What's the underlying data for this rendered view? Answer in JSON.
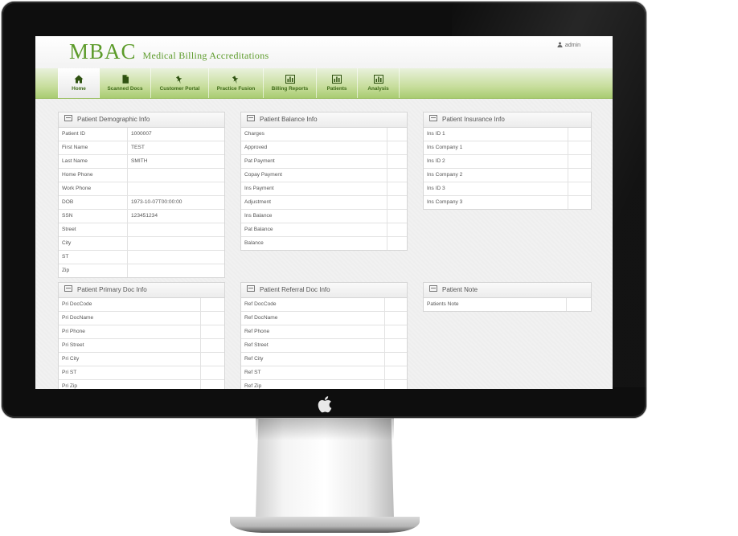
{
  "app": {
    "logo_main": "MBAC",
    "logo_sub": "Medical Billing Accreditations",
    "user": "admin"
  },
  "nav": [
    {
      "label": "Home",
      "icon": "home-icon",
      "active": true
    },
    {
      "label": "Scanned Docs",
      "icon": "document-icon",
      "active": false
    },
    {
      "label": "Customer Portal",
      "icon": "pushpin-icon",
      "active": false
    },
    {
      "label": "Practice Fusion",
      "icon": "pushpin-icon",
      "active": false
    },
    {
      "label": "Billing Reports",
      "icon": "bar-chart-icon",
      "active": false
    },
    {
      "label": "Patients",
      "icon": "bar-chart-icon",
      "active": false
    },
    {
      "label": "Analysis",
      "icon": "bar-chart-icon",
      "active": false
    }
  ],
  "panels": {
    "demographic": {
      "title": "Patient Demographic Info",
      "rows": [
        {
          "label": "Patient ID",
          "value": "1000007"
        },
        {
          "label": "First Name",
          "value": "TEST"
        },
        {
          "label": "Last Name",
          "value": "SMITH"
        },
        {
          "label": "Home Phone",
          "value": ""
        },
        {
          "label": "Work Phone",
          "value": ""
        },
        {
          "label": "DOB",
          "value": "1973-10-07T00:00:00"
        },
        {
          "label": "SSN",
          "value": "123451234"
        },
        {
          "label": "Street",
          "value": ""
        },
        {
          "label": "City",
          "value": ""
        },
        {
          "label": "ST",
          "value": ""
        },
        {
          "label": "Zip",
          "value": ""
        }
      ]
    },
    "balance": {
      "title": "Patient Balance Info",
      "rows": [
        {
          "label": "Charges",
          "value": ""
        },
        {
          "label": "Approved",
          "value": ""
        },
        {
          "label": "Pat Payment",
          "value": ""
        },
        {
          "label": "Copay Payment",
          "value": ""
        },
        {
          "label": "Ins Payment",
          "value": ""
        },
        {
          "label": "Adjustment",
          "value": ""
        },
        {
          "label": "Ins Balance",
          "value": ""
        },
        {
          "label": "Pat Balance",
          "value": ""
        },
        {
          "label": "Balance",
          "value": ""
        }
      ]
    },
    "insurance": {
      "title": "Patient Insurance Info",
      "rows": [
        {
          "label": "Ins ID 1",
          "value": ""
        },
        {
          "label": "Ins Company 1",
          "value": ""
        },
        {
          "label": "Ins ID 2",
          "value": ""
        },
        {
          "label": "Ins Company 2",
          "value": ""
        },
        {
          "label": "Ins ID 3",
          "value": ""
        },
        {
          "label": "Ins Company 3",
          "value": ""
        }
      ]
    },
    "primary_doc": {
      "title": "Patient Primary Doc Info",
      "rows": [
        {
          "label": "Pri DocCode",
          "value": ""
        },
        {
          "label": "Pri DocName",
          "value": ""
        },
        {
          "label": "Pri Phone",
          "value": ""
        },
        {
          "label": "Pri Street",
          "value": ""
        },
        {
          "label": "Pri City",
          "value": ""
        },
        {
          "label": "Pri ST",
          "value": ""
        },
        {
          "label": "Pri Zip",
          "value": ""
        }
      ]
    },
    "referral_doc": {
      "title": "Patient Referral Doc Info",
      "rows": [
        {
          "label": "Ref DocCode",
          "value": ""
        },
        {
          "label": "Ref DocName",
          "value": ""
        },
        {
          "label": "Ref Phone",
          "value": ""
        },
        {
          "label": "Ref Street",
          "value": ""
        },
        {
          "label": "Ref City",
          "value": ""
        },
        {
          "label": "Ref ST",
          "value": ""
        },
        {
          "label": "Ref Zip",
          "value": ""
        }
      ]
    },
    "note": {
      "title": "Patient Note",
      "rows": [
        {
          "label": "Patients Note",
          "value": ""
        }
      ]
    }
  },
  "colors": {
    "brand": "#5c9b2a",
    "nav_gradient_end": "#a9cc71",
    "nav_text": "#3e6a18"
  }
}
